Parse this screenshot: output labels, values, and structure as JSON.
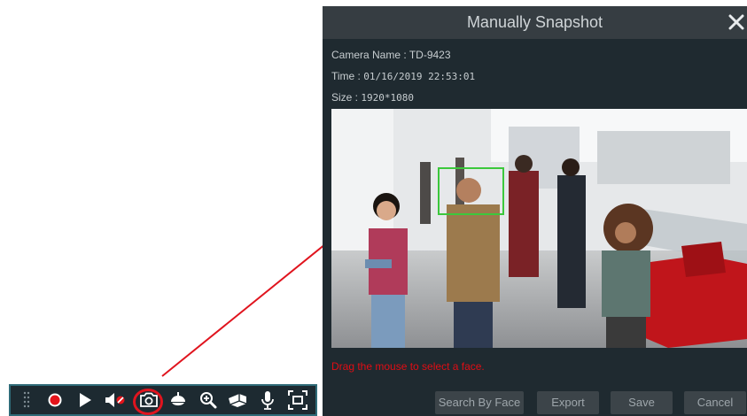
{
  "dialog": {
    "title": "Manually Snapshot",
    "camera_name_label": "Camera Name :",
    "camera_name": "TD-9423",
    "time_label": "Time :",
    "time": "01/16/2019 22:53:01",
    "size_label": "Size :",
    "size": "1920*1080",
    "hint": "Drag the mouse to select a face.",
    "buttons": {
      "search_by_face": "Search By Face",
      "export": "Export",
      "save": "Save",
      "cancel": "Cancel"
    }
  },
  "toolbar": {
    "icons": [
      "drag-handle-icon",
      "record-icon",
      "play-icon",
      "mute-icon",
      "snapshot-icon",
      "ptz-icon",
      "zoom-in-icon",
      "fisheye-icon",
      "microphone-icon",
      "fit-screen-icon"
    ],
    "highlighted": "snapshot-icon"
  },
  "colors": {
    "dialog_bg": "#1f2a30",
    "header_bg": "#363d42",
    "hint_text": "#e10d14",
    "annotation": "#e0141e",
    "face_box": "#3cc83c"
  }
}
